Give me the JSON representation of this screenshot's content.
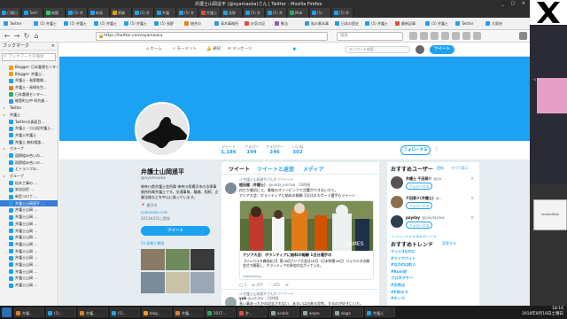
{
  "window": {
    "title": "弁護士山岡遥平 (@oyamaoka)さん | Twitter - Mozilla Firefox",
    "controls": "_ □ ×"
  },
  "top_tabs": [
    {
      "label": "日曜日",
      "color": "#1da1f2"
    },
    {
      "label": "Twitt",
      "color": "#1da1f2"
    },
    {
      "label": "無題",
      "color": "#2ecc71"
    },
    {
      "label": "(5) 弁",
      "color": "#1da1f2"
    },
    {
      "label": "新島",
      "color": "#1da1f2"
    },
    {
      "label": "実験",
      "color": "#f39c12"
    },
    {
      "label": "(5) 弁",
      "color": "#1da1f2"
    },
    {
      "label": "弁護",
      "color": "#1da1f2"
    },
    {
      "label": "(5) 弁",
      "color": "#1da1f2"
    },
    {
      "label": "弁護士",
      "color": "#e74c3c"
    },
    {
      "label": "長野",
      "color": "#1da1f2"
    },
    {
      "label": "(5) 弁",
      "color": "#1da1f2"
    },
    {
      "label": "(5) 弁",
      "color": "#1da1f2"
    },
    {
      "label": "Mob",
      "color": "#27ae60"
    },
    {
      "label": "(5)",
      "color": "#1da1f2"
    },
    {
      "label": "(5) 弁",
      "color": "#1da1f2"
    }
  ],
  "bookmark_tabs": [
    {
      "label": "Twitter",
      "color": "#1da1f2"
    },
    {
      "label": "(5) 弁護士",
      "color": "#1da1f2"
    },
    {
      "label": "(5) 弁護士",
      "color": "#1da1f2"
    },
    {
      "label": "(5) 弁護士",
      "color": "#1da1f2"
    },
    {
      "label": "(5) 弁護士",
      "color": "#1da1f2"
    },
    {
      "label": "(5) 長野",
      "color": "#1da1f2"
    },
    {
      "label": "総合の",
      "color": "#e67e22"
    },
    {
      "label": "高木事務所",
      "color": "#3498db"
    },
    {
      "label": "お気の記",
      "color": "#e74c3c"
    },
    {
      "label": "動法",
      "color": "#9b59b6"
    },
    {
      "label": "私の基本事",
      "color": "#3498db"
    },
    {
      "label": "日本の歴史",
      "color": "#1da1f2"
    },
    {
      "label": "(5) 弁護士",
      "color": "#1da1f2"
    },
    {
      "label": "最新記事",
      "color": "#e74c3c"
    },
    {
      "label": "(5) 弁護士",
      "color": "#1da1f2"
    },
    {
      "label": "Twitter",
      "color": "#1da1f2"
    },
    {
      "label": "大阪府",
      "color": "#1da1f2"
    }
  ],
  "urlbar": {
    "url": "https://twitter.com/oyamaoka",
    "search_placeholder": "検索"
  },
  "sidebar": {
    "title": "ブックマーク",
    "search_placeholder": "ブックマークを検索",
    "items": [
      {
        "label": "Blogger: 日本重建センター",
        "indent": 1,
        "color": "#f39c12"
      },
      {
        "label": "Blogger: 弁護士...",
        "indent": 1,
        "color": "#f39c12"
      },
      {
        "label": "弁護士・長野重剛...",
        "indent": 1,
        "color": "#1da1f2"
      },
      {
        "label": "弁護士・長崎先生...",
        "indent": 1,
        "color": "#e67e22"
      },
      {
        "label": "日本重建センター...",
        "indent": 1,
        "color": "#27ae60"
      },
      {
        "label": "能登町山中 研究者...",
        "indent": 1,
        "color": "#3498db"
      },
      {
        "label": "Twitter",
        "indent": 0,
        "folder": true
      },
      {
        "label": "弁護士",
        "indent": 0,
        "folder": true
      },
      {
        "label": "Twitterの真面目...",
        "indent": 1,
        "color": "#1da1f2"
      },
      {
        "label": "弁護士・小山紀弁護士...",
        "indent": 1,
        "color": "#1da1f2"
      },
      {
        "label": "弁護士弁護士",
        "indent": 1,
        "color": "#1da1f2"
      },
      {
        "label": "弁護士 無料相談...",
        "indent": 1,
        "color": "#1da1f2"
      },
      {
        "label": "グループ",
        "indent": 0,
        "folder": true
      },
      {
        "label": "国際組み合いの...",
        "indent": 1,
        "color": "#1da1f2"
      },
      {
        "label": "国際組み合いの...",
        "indent": 1,
        "color": "#1da1f2"
      },
      {
        "label": "とトランプの...",
        "indent": 1,
        "color": "#1da1f2"
      },
      {
        "label": "グループ",
        "indent": 0,
        "folder": true
      },
      {
        "label": "松本工事の ...",
        "indent": 1,
        "color": "#1da1f2"
      },
      {
        "label": "安倍自民 ...",
        "indent": 1,
        "color": "#1da1f2"
      },
      {
        "label": "新型コロナ ...",
        "indent": 1,
        "color": "#1da1f2"
      },
      {
        "label": "弁護士山岡遥平 ...",
        "indent": 1,
        "color": "#1da1f2",
        "selected": true
      },
      {
        "label": "弁護士山岡 ...",
        "indent": 1,
        "color": "#1da1f2"
      },
      {
        "label": "弁護士山岡 ...",
        "indent": 1,
        "color": "#1da1f2"
      },
      {
        "label": "弁護士山岡 ...",
        "indent": 1,
        "color": "#1da1f2"
      },
      {
        "label": "弁護士山岡 ...",
        "indent": 1,
        "color": "#1da1f2"
      },
      {
        "label": "弁護士山岡 ...",
        "indent": 1,
        "color": "#1da1f2"
      },
      {
        "label": "弁護士山岡 ...",
        "indent": 1,
        "color": "#1da1f2"
      },
      {
        "label": "弁護士山岡 ...",
        "indent": 1,
        "color": "#1da1f2"
      },
      {
        "label": "弁護士山岡 ...",
        "indent": 1,
        "color": "#1da1f2"
      },
      {
        "label": "弁護士山岡 ...",
        "indent": 1,
        "color": "#1da1f2"
      },
      {
        "label": "弁護士山岡 ...",
        "indent": 1,
        "color": "#1da1f2"
      },
      {
        "label": "弁護士山岡 ...",
        "indent": 1,
        "color": "#1da1f2"
      },
      {
        "label": "弁護士山岡 ...",
        "indent": 1,
        "color": "#1da1f2"
      }
    ]
  },
  "twitter": {
    "nav": {
      "home": "ホーム",
      "moments": "モーメント",
      "notifications": "通知",
      "messages": "メッセージ",
      "search_placeholder": "キーワード検索",
      "tweet": "ツイート"
    },
    "stats": [
      {
        "label": "ツイート",
        "value": "1,186"
      },
      {
        "label": "フォロー",
        "value": "194"
      },
      {
        "label": "フォロワー",
        "value": "246"
      },
      {
        "label": "いいね",
        "value": "302"
      }
    ],
    "follow_button": "フォローする",
    "profile": {
      "name": "弁護士山岡遥平",
      "handle": "@oyamaoka",
      "bio": "神奈川県弁護士会所属 神奈川県横浜市の法律事務所所属弁護士です。交通事故、離婚、相続、企業法務などを中心に扱っています。",
      "location": "横浜市",
      "link": "oyamaoka.com",
      "joined": "2013年2月に登録",
      "tweet_button": "ツイート",
      "media_label": "33 画像と動画"
    },
    "timeline": {
      "tabs": [
        "ツイート",
        "ツイートと返信",
        "メディア"
      ],
      "retweet_note": "弁護士山岡遥平さんがリツイート",
      "tweet1_name": "植田健（弁護士）",
      "tweet1_handle": "@ueda_kenlaw · 16時間",
      "tweet1_text": "何だか最初にと、最後のオリンピックで活躍ができないかと。",
      "tweet1_quote": "アジア大会：ボランティアに給料の報酬 1日分のスポーツ選手もツイート",
      "card_title": "アジア大会：ボランティアに給料の報酬 1日分選手の",
      "card_desc": "【ジャカルタ森岡宏之】第18回アジア大会は18日（日本時間18日）ジャカルタの開会式で開幕し、ボランティアの参加が広がっている。",
      "card_domain": "mainichi.jp",
      "actions": {
        "reply": "1",
        "retweet": "377",
        "like": "372"
      },
      "tweet2_note": "弁護士山岡遥平さんがリツイート",
      "tweet2_name": "yuk",
      "tweet2_handle": "@yuklaw · 16時間",
      "tweet2_text": "長い事あったかの記念されない、あるいは出来る思考。するのが好きにいた。",
      "tweet3_name": "弁護士山岡遥平",
      "tweet3_handle": "@oyamaoka"
    },
    "who_to_follow": {
      "title": "おすすめユーザー",
      "refresh": "更新",
      "all": "すべて表示",
      "users": [
        {
          "name": "弁護士 千田泰介",
          "handle": "@yo...",
          "button": "フォローする"
        },
        {
          "name": "千田泰介(弁護士)",
          "handle": "@...",
          "button": "フォローする"
        },
        {
          "name": "payday",
          "handle": "@paydaylaw",
          "button": "フォローする"
        }
      ],
      "more": "フォローする友達を見つける"
    },
    "trends": {
      "title": "おすすめトレンド",
      "change": "変更する",
      "items": [
        "マッシ3なのに",
        "#ツイアバイト",
        "#なかのは町人",
        "#Koin学",
        "プロボクサー",
        "#女性は",
        "#FIDキラ",
        "#チーウ"
      ]
    }
  },
  "taskbar": {
    "items": [
      {
        "label": "弁護...",
        "color": "#e67e22"
      },
      {
        "label": "(5)...",
        "color": "#1da1f2"
      },
      {
        "label": "弁護...",
        "color": "#e67e22"
      },
      {
        "label": "(5)...",
        "color": "#1da1f2"
      },
      {
        "label": "blog...",
        "color": "#f39c12"
      },
      {
        "label": "弁護...",
        "color": "#e67e22"
      },
      {
        "label": "2017...",
        "color": "#27ae60"
      },
      {
        "label": "弁...",
        "color": "#e74c3c"
      },
      {
        "label": "oclock",
        "color": "#95a5a6"
      },
      {
        "label": "xeyes",
        "color": "#95a5a6"
      },
      {
        "label": "xlogo",
        "color": "#95a5a6"
      },
      {
        "label": "弁護士",
        "color": "#1da1f2"
      }
    ],
    "clock_time": "18:16",
    "clock_date": "2018年8月18日土曜日"
  },
  "side_panel": {
    "terminal_text": "~$ xeyes",
    "box_label": "screenShot"
  }
}
